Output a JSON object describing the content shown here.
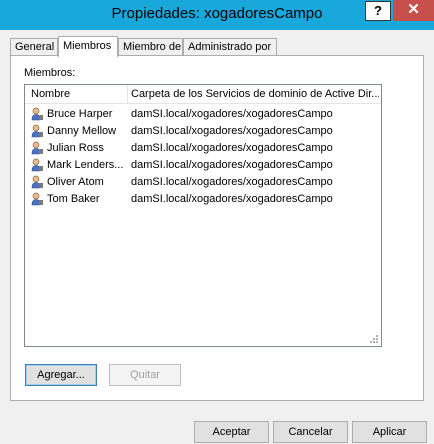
{
  "window": {
    "title": "Propiedades: xogadoresCampo",
    "help_label": "?",
    "close_label": "✕"
  },
  "tabs": [
    {
      "label": "General",
      "active": false
    },
    {
      "label": "Miembros",
      "active": true
    },
    {
      "label": "Miembro de",
      "active": false
    },
    {
      "label": "Administrado por",
      "active": false
    }
  ],
  "members": {
    "label": "Miembros:",
    "columns": [
      "Nombre",
      "Carpeta de los Servicios de dominio de Active Dir..."
    ],
    "rows": [
      {
        "name": "Bruce Harper",
        "folder": "damSI.local/xogadores/xogadoresCampo"
      },
      {
        "name": "Danny Mellow",
        "folder": "damSI.local/xogadores/xogadoresCampo"
      },
      {
        "name": "Julian Ross",
        "folder": "damSI.local/xogadores/xogadoresCampo"
      },
      {
        "name": "Mark Lenders...",
        "folder": "damSI.local/xogadores/xogadoresCampo"
      },
      {
        "name": "Oliver Atom",
        "folder": "damSI.local/xogadores/xogadoresCampo"
      },
      {
        "name": "Tom Baker",
        "folder": "damSI.local/xogadores/xogadoresCampo"
      }
    ]
  },
  "actions": {
    "add_label": "Agregar...",
    "remove_label": "Quitar"
  },
  "footer": {
    "ok_label": "Aceptar",
    "cancel_label": "Cancelar",
    "apply_label": "Aplicar"
  }
}
